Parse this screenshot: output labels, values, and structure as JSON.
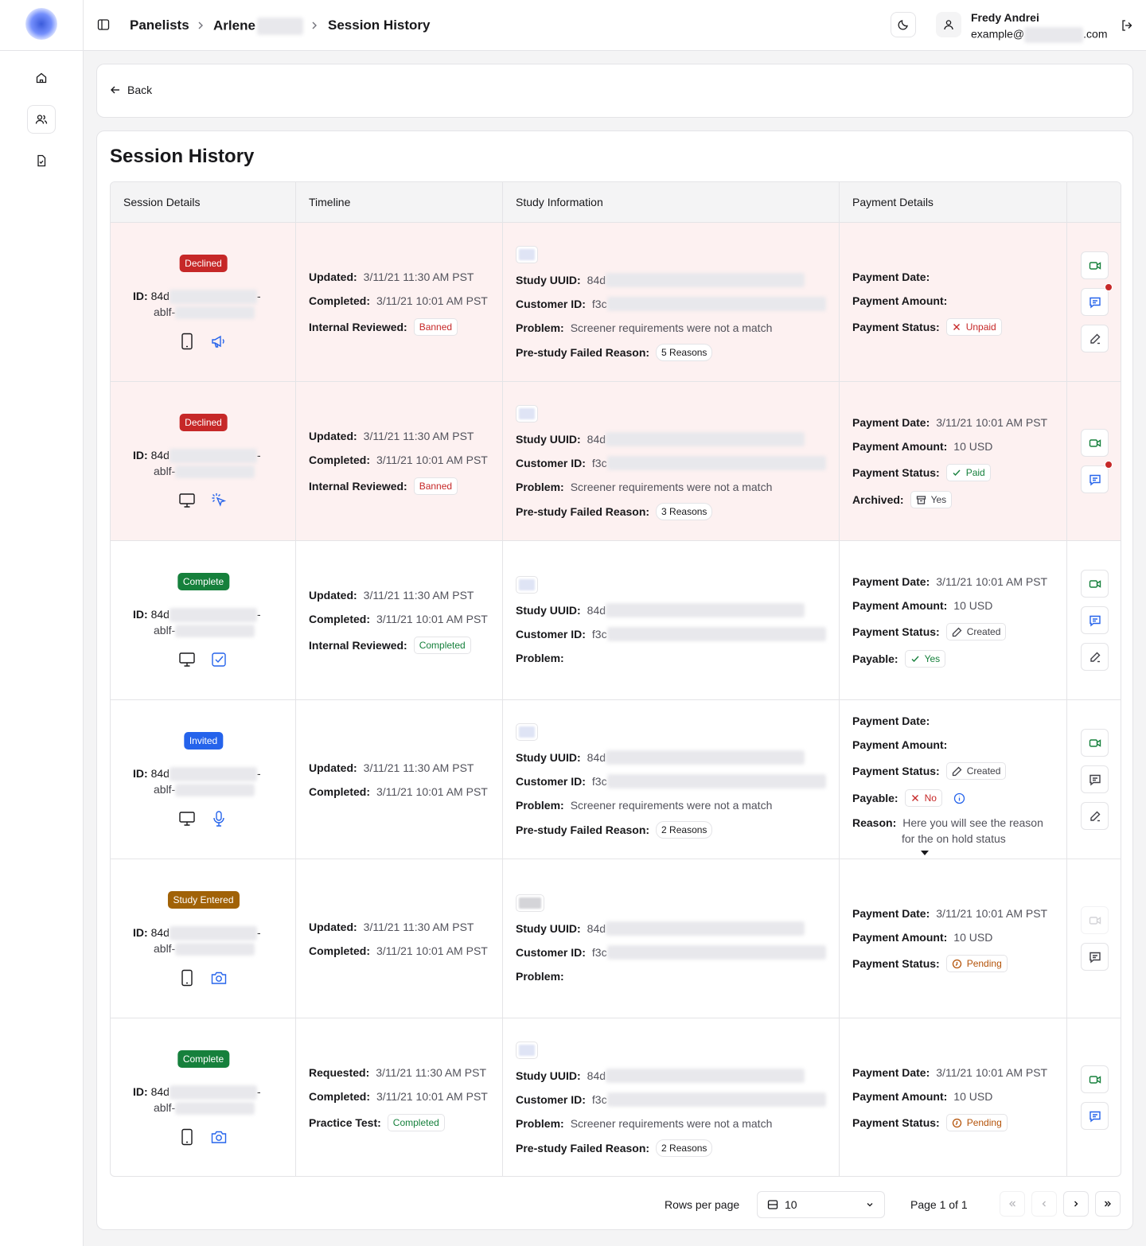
{
  "breadcrumb": {
    "item1": "Panelists",
    "item2": "Arlene",
    "item3": "Session History"
  },
  "user": {
    "name": "Fredy Andrei",
    "email_prefix": "example@",
    "email_suffix": ".com"
  },
  "back_label": "Back",
  "page_title": "Session History",
  "headers": {
    "session": "Session Details",
    "timeline": "Timeline",
    "study": "Study Information",
    "payment": "Payment Details"
  },
  "labels": {
    "id": "ID:",
    "updated": "Updated:",
    "requested": "Requested:",
    "completed": "Completed:",
    "internal_reviewed": "Internal Reviewed:",
    "practice_test": "Practice Test:",
    "study_uuid": "Study UUID:",
    "customer_id": "Customer ID:",
    "problem": "Problem:",
    "prestudy": "Pre-study Failed Reason:",
    "payment_date": "Payment Date:",
    "payment_amount": "Payment Amount:",
    "payment_status": "Payment Status:",
    "archived": "Archived:",
    "payable": "Payable:",
    "reason": "Reason:"
  },
  "rows": [
    {
      "status": "Declined",
      "id_prefix": "84d",
      "id_line2": "ablf-",
      "device": "mobile-icon",
      "type_icon": "megaphone-icon",
      "updated": "3/11/21 11:30 AM PST",
      "completed": "3/11/21 10:01 AM PST",
      "review": "Banned",
      "uuid_prefix": "84d",
      "customer_prefix": "f3c",
      "problem": "Screener requirements were not a match",
      "prestudy": "5 Reasons",
      "payment_status": "Unpaid"
    },
    {
      "status": "Declined",
      "id_prefix": "84d",
      "id_line2": "ablf-",
      "device": "desktop-icon",
      "type_icon": "click-icon",
      "updated": "3/11/21 11:30 AM PST",
      "completed": "3/11/21 10:01 AM PST",
      "review": "Banned",
      "uuid_prefix": "84d",
      "customer_prefix": "f3c",
      "problem": "Screener requirements were not a match",
      "prestudy": "3 Reasons",
      "payment_date": "3/11/21 10:01 AM PST",
      "payment_amount": "10 USD",
      "payment_status": "Paid",
      "archived": "Yes"
    },
    {
      "status": "Complete",
      "id_prefix": "84d",
      "id_line2": "ablf-",
      "device": "desktop-icon",
      "type_icon": "checkbox-icon",
      "updated": "3/11/21 11:30 AM PST",
      "completed": "3/11/21 10:01 AM PST",
      "review": "Completed",
      "uuid_prefix": "84d",
      "customer_prefix": "f3c",
      "payment_date": "3/11/21 10:01 AM PST",
      "payment_amount": "10 USD",
      "payment_status": "Created",
      "payable": "Yes"
    },
    {
      "status": "Invited",
      "id_prefix": "84d",
      "id_line2": "ablf-",
      "device": "desktop-icon",
      "type_icon": "microphone-icon",
      "updated": "3/11/21 11:30 AM PST",
      "completed": "3/11/21 10:01 AM PST",
      "uuid_prefix": "84d",
      "customer_prefix": "f3c",
      "problem": "Screener requirements were not a match",
      "prestudy": "2 Reasons",
      "payment_status": "Created",
      "payable": "No",
      "reason_line1": "Here you will see the reason",
      "reason_line2": "for the on hold status"
    },
    {
      "status": "Study Entered",
      "id_prefix": "84d",
      "id_line2": "ablf-",
      "device": "mobile-icon",
      "type_icon": "camera-icon",
      "updated": "3/11/21 11:30 AM PST",
      "completed": "3/11/21 10:01 AM PST",
      "uuid_prefix": "84d",
      "customer_prefix": "f3c",
      "payment_date": "3/11/21 10:01 AM PST",
      "payment_amount": "10 USD",
      "payment_status": "Pending"
    },
    {
      "status": "Complete",
      "id_prefix": "84d",
      "id_line2": "ablf-",
      "device": "mobile-icon",
      "type_icon": "camera-icon",
      "requested": "3/11/21 11:30 AM PST",
      "completed": "3/11/21 10:01 AM PST",
      "practice": "Completed",
      "uuid_prefix": "84d",
      "customer_prefix": "f3c",
      "problem": "Screener requirements were not a match",
      "prestudy": "2 Reasons",
      "payment_date": "3/11/21 10:01 AM PST",
      "payment_amount": "10 USD",
      "payment_status": "Pending"
    }
  ],
  "pagination": {
    "rows_per_page_label": "Rows per page",
    "rows_per_page_value": "10",
    "page_info": "Page 1 of 1"
  },
  "colors": {
    "declined": "#c62828",
    "complete": "#16803c",
    "invited": "#2563eb",
    "study_entered": "#a16207",
    "row_highlight": "#fdf1f1"
  }
}
